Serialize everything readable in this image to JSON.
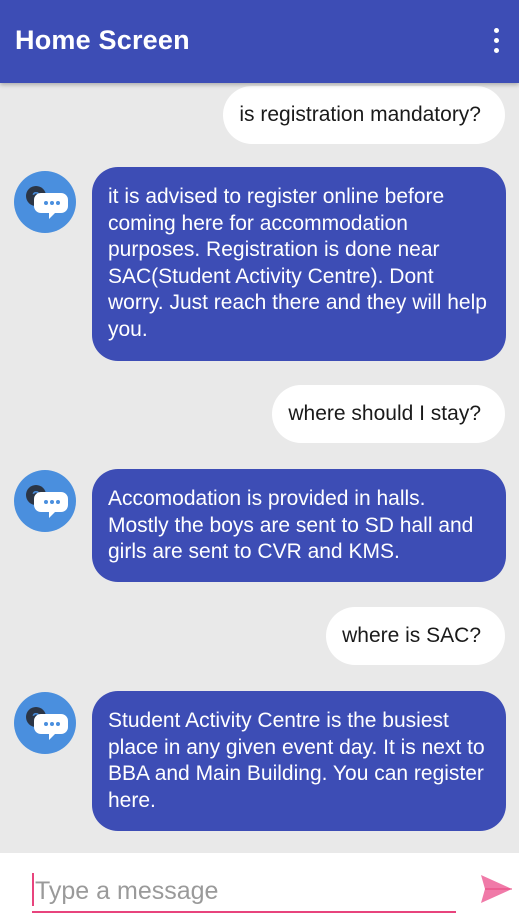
{
  "appbar": {
    "title": "Home Screen",
    "menu_icon": "more-vert-icon",
    "background": "#3d4db5"
  },
  "messages": [
    {
      "sender": "user",
      "text": "is registration mandatory?"
    },
    {
      "sender": "bot",
      "text": "it is advised to register online before coming here for accommodation purposes. Registration is done near SAC(Student Activity Centre). Dont worry. Just reach there and they will help you."
    },
    {
      "sender": "user",
      "text": "where should I stay?"
    },
    {
      "sender": "bot",
      "text": "Accomodation is provided in halls. Mostly the boys are sent to SD hall and girls are sent to CVR and KMS."
    },
    {
      "sender": "user",
      "text": "where is SAC?"
    },
    {
      "sender": "bot",
      "text": "Student Activity Centre is the busiest place in any given event day. It is next to BBA and Main Building. You can register here."
    }
  ],
  "bot_avatar_icon": "chat-bubble-question-icon",
  "input": {
    "placeholder": "Type a message",
    "value": ""
  },
  "send_icon": "send-icon",
  "colors": {
    "bot_bubble": "#3d4db5",
    "user_bubble": "#ffffff",
    "accent": "#e8447d",
    "avatar": "#4a8fde"
  }
}
